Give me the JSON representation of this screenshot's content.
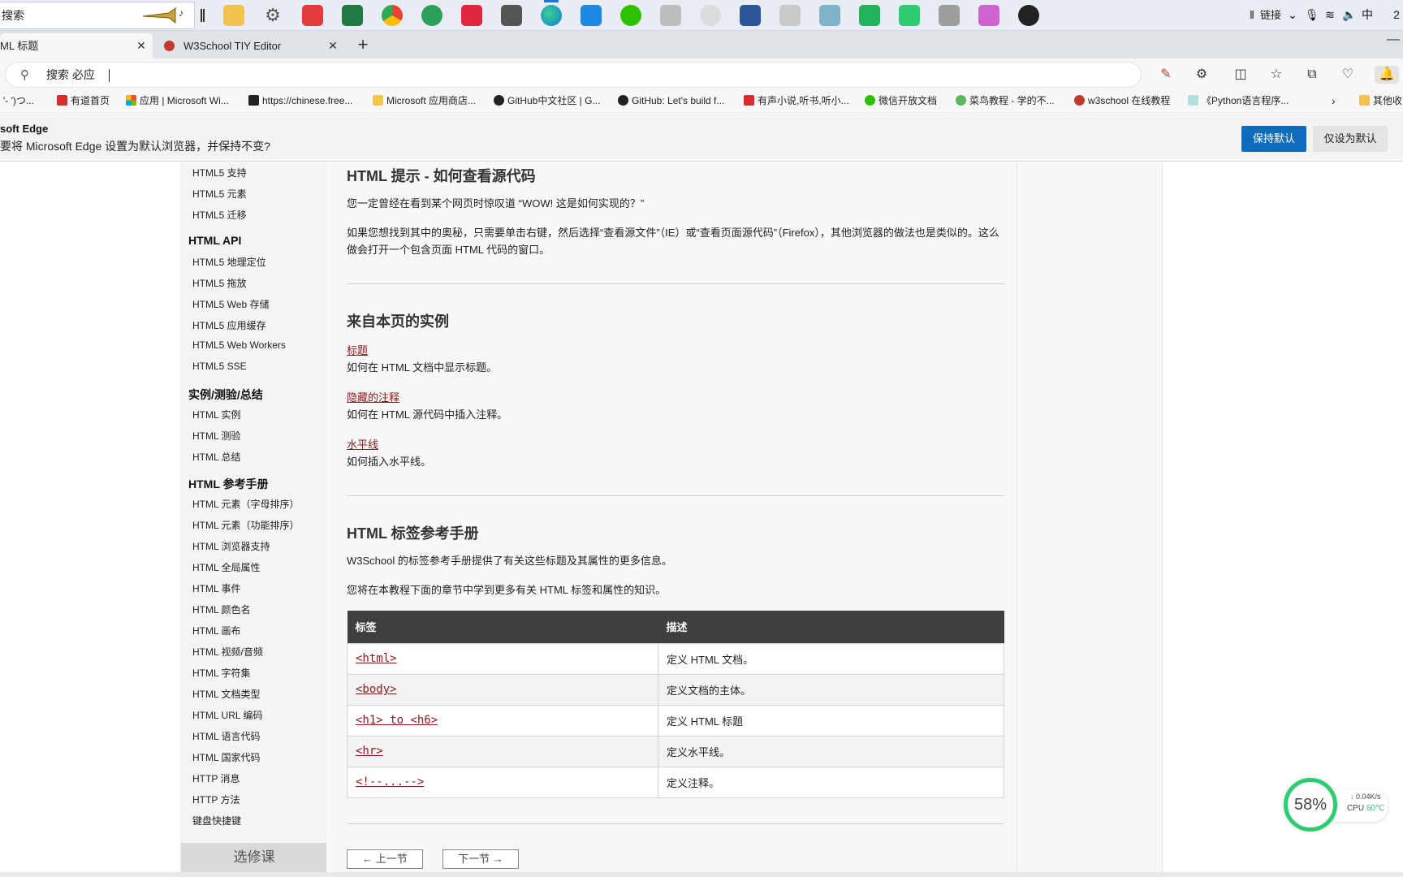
{
  "taskbar": {
    "search_text": "搜索",
    "tray_links": "链接",
    "ime": "中",
    "clock": "2"
  },
  "tabs": [
    {
      "label": "ML 标题"
    },
    {
      "label": "W3School TIY Editor"
    }
  ],
  "addressbar": {
    "text": "搜索 必应"
  },
  "bookmarks": [
    {
      "label": "'- ')つ..."
    },
    {
      "label": "有道首页"
    },
    {
      "label": "应用 | Microsoft Wi..."
    },
    {
      "label": "https://chinese.free..."
    },
    {
      "label": "Microsoft 应用商店..."
    },
    {
      "label": "GitHub中文社区 | G..."
    },
    {
      "label": "GitHub: Let's build f..."
    },
    {
      "label": "有声小说,听书,听小..."
    },
    {
      "label": "微信开放文档"
    },
    {
      "label": "菜鸟教程 - 学的不..."
    },
    {
      "label": "w3school 在线教程"
    },
    {
      "label": "《Python语言程序..."
    },
    {
      "label": "其他收"
    }
  ],
  "notice": {
    "title": "soft Edge",
    "message": "要将 Microsoft Edge 设置为默认浏览器，并保持不变?",
    "keep_default": "保持默认",
    "set_default_only": "仅设为默认"
  },
  "sidebar": {
    "items": [
      {
        "label": "HTML5 支持",
        "kind": "item"
      },
      {
        "label": "HTML5 元素",
        "kind": "item"
      },
      {
        "label": "HTML5 迁移",
        "kind": "item"
      },
      {
        "label": "HTML API",
        "kind": "head"
      },
      {
        "label": "HTML5 地理定位",
        "kind": "item"
      },
      {
        "label": "HTML5 拖放",
        "kind": "item"
      },
      {
        "label": "HTML5 Web 存储",
        "kind": "item"
      },
      {
        "label": "HTML5 应用缓存",
        "kind": "item"
      },
      {
        "label": "HTML5 Web Workers",
        "kind": "item"
      },
      {
        "label": "HTML5 SSE",
        "kind": "item"
      },
      {
        "label": "实例/测验/总结",
        "kind": "head"
      },
      {
        "label": "HTML 实例",
        "kind": "item"
      },
      {
        "label": "HTML 测验",
        "kind": "item"
      },
      {
        "label": "HTML 总结",
        "kind": "item"
      },
      {
        "label": "HTML 参考手册",
        "kind": "head"
      },
      {
        "label": "HTML 元素（字母排序）",
        "kind": "item"
      },
      {
        "label": "HTML 元素（功能排序）",
        "kind": "item"
      },
      {
        "label": "HTML 浏览器支持",
        "kind": "item"
      },
      {
        "label": "HTML 全局属性",
        "kind": "item"
      },
      {
        "label": "HTML 事件",
        "kind": "item"
      },
      {
        "label": "HTML 颜色名",
        "kind": "item"
      },
      {
        "label": "HTML 画布",
        "kind": "item"
      },
      {
        "label": "HTML 视频/音频",
        "kind": "item"
      },
      {
        "label": "HTML 字符集",
        "kind": "item"
      },
      {
        "label": "HTML 文档类型",
        "kind": "item"
      },
      {
        "label": "HTML URL 编码",
        "kind": "item"
      },
      {
        "label": "HTML 语言代码",
        "kind": "item"
      },
      {
        "label": "HTML 国家代码",
        "kind": "item"
      },
      {
        "label": "HTTP 消息",
        "kind": "item"
      },
      {
        "label": "HTTP 方法",
        "kind": "item"
      },
      {
        "label": "键盘快捷键",
        "kind": "item"
      }
    ],
    "course_label": "选修课"
  },
  "content": {
    "tip_heading": "HTML 提示 - 如何查看源代码",
    "tip_p1": "您一定曾经在看到某个网页时惊叹道 “WOW! 这是如何实现的？”",
    "tip_p2": "如果您想找到其中的奥秘，只需要单击右键，然后选择“查看源文件”（IE）或“查看页面源代码”（Firefox），其他浏览器的做法也是类似的。这么做会打开一个包含页面 HTML 代码的窗口。",
    "examples_heading": "来自本页的实例",
    "examples": [
      {
        "link": "标题",
        "desc": "如何在 HTML 文档中显示标题。"
      },
      {
        "link": "隐藏的注释",
        "desc": "如何在 HTML 源代码中插入注释。"
      },
      {
        "link": "水平线",
        "desc": "如何插入水平线。"
      }
    ],
    "ref_heading": "HTML 标签参考手册",
    "ref_p1": "W3School 的标签参考手册提供了有关这些标题及其属性的更多信息。",
    "ref_p2": "您将在本教程下面的章节中学到更多有关 HTML 标签和属性的知识。",
    "table": {
      "headers": [
        "标签",
        "描述"
      ],
      "rows": [
        {
          "tag": "<html>",
          "desc": "定义 HTML 文档。"
        },
        {
          "tag": "<body>",
          "desc": "定义文档的主体。"
        },
        {
          "tag": "<h1> to <h6>",
          "desc": "定义 HTML 标题"
        },
        {
          "tag": "<hr>",
          "desc": "定义水平线。"
        },
        {
          "tag": "<!--...-->",
          "desc": "定义注释。"
        }
      ]
    },
    "prev_label": "上一节",
    "next_label": "下一节"
  },
  "widget": {
    "percent": "58%",
    "net_speed": "0.04K/s",
    "cpu_label": "CPU",
    "cpu_temp": "60℃"
  },
  "colors": {
    "link": "#8b1a1a",
    "primary_button": "#0f6cbd",
    "table_header": "#3f3f3f",
    "gauge": "#2ecc71"
  }
}
